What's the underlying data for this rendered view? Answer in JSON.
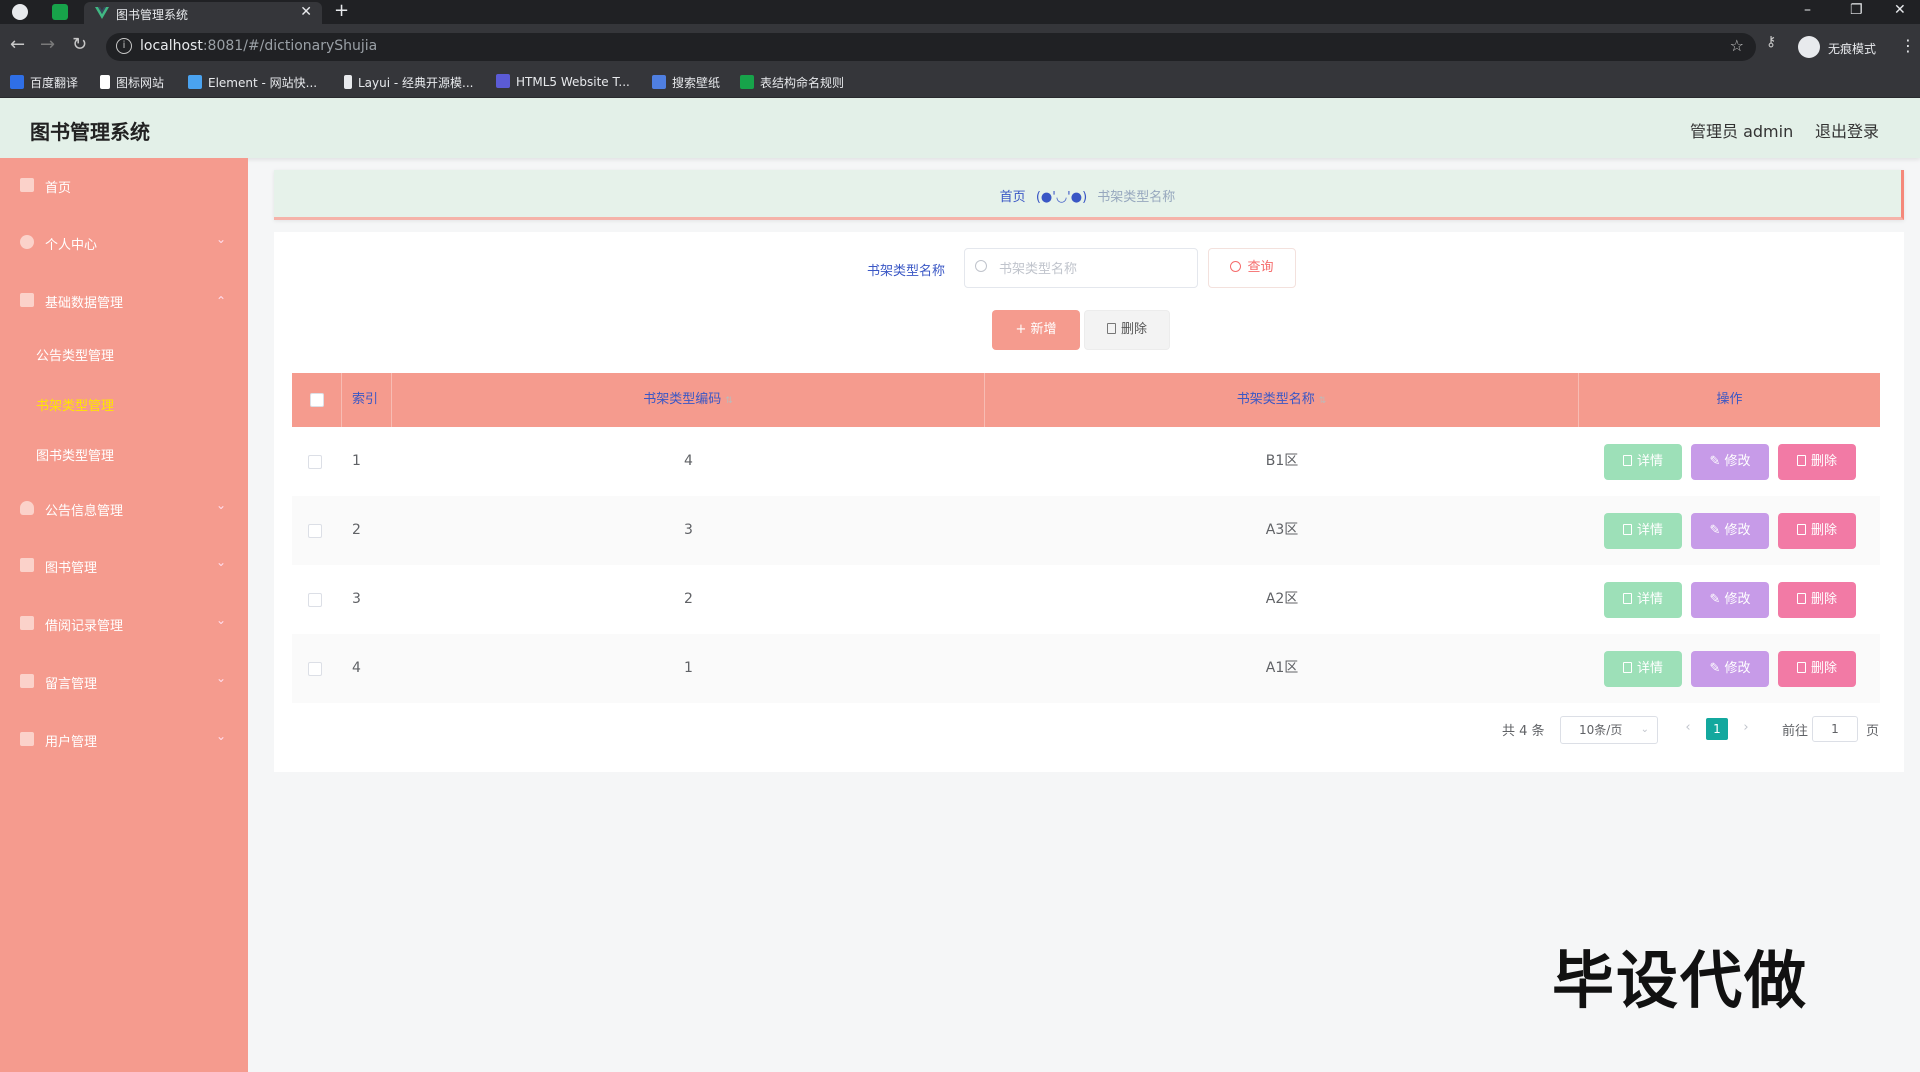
{
  "browser": {
    "tab_title": "图书管理系统",
    "url_host": "localhost",
    "url_path": ":8081/#/dictionaryShujia",
    "incognito_label": "无痕模式",
    "bookmarks": [
      {
        "label": "百度翻译",
        "color": "#2f6fe6"
      },
      {
        "label": "图标网站",
        "color": "#ffffff"
      },
      {
        "label": "Element - 网站快...",
        "color": "#4aa3f0"
      },
      {
        "label": "Layui - 经典开源模...",
        "color": "#e8eaed"
      },
      {
        "label": "HTML5 Website T...",
        "color": "#5b5bd6"
      },
      {
        "label": "搜索壁纸",
        "color": "#4f7fe0"
      },
      {
        "label": "表结构命名规则",
        "color": "#17a34a"
      }
    ]
  },
  "header": {
    "title": "图书管理系统",
    "admin_label": "管理员 admin",
    "logout_label": "退出登录"
  },
  "sidebar": {
    "items": [
      {
        "label": "首页",
        "icon": "home-icon"
      },
      {
        "label": "个人中心",
        "icon": "user-icon"
      },
      {
        "label": "基础数据管理",
        "icon": "database-icon"
      },
      {
        "label": "公告信息管理",
        "icon": "bulb-icon"
      },
      {
        "label": "图书管理",
        "icon": "book-icon"
      },
      {
        "label": "借阅记录管理",
        "icon": "grid-icon"
      },
      {
        "label": "留言管理",
        "icon": "message-icon"
      },
      {
        "label": "用户管理",
        "icon": "users-icon"
      }
    ],
    "sub_items": [
      {
        "label": "公告类型管理"
      },
      {
        "label": "书架类型管理"
      },
      {
        "label": "图书类型管理"
      }
    ]
  },
  "breadcrumb": {
    "home": "首页",
    "face": "(●'◡'●)",
    "current": "书架类型名称"
  },
  "search": {
    "label": "书架类型名称",
    "placeholder": "书架类型名称",
    "query_button": "查询"
  },
  "actions": {
    "add_label": "新增",
    "delete_label": "删除"
  },
  "table": {
    "headers": [
      "索引",
      "书架类型编码",
      "书架类型名称",
      "操作"
    ],
    "rows": [
      {
        "index": "1",
        "code": "4",
        "name": "B1区"
      },
      {
        "index": "2",
        "code": "3",
        "name": "A3区"
      },
      {
        "index": "3",
        "code": "2",
        "name": "A2区"
      },
      {
        "index": "4",
        "code": "1",
        "name": "A1区"
      }
    ],
    "row_actions": {
      "detail": "详情",
      "edit": "修改",
      "delete": "删除"
    }
  },
  "pagination": {
    "total": "共 4 条",
    "page_size": "10条/页",
    "current_page": "1",
    "goto_label": "前往",
    "goto_value": "1",
    "page_suffix": "页"
  },
  "watermark": "毕设代做",
  "colors": {
    "sidebar": "#f59b8e",
    "header_bg": "#e3f0e8",
    "accent_blue": "#3a57c5",
    "detail": "#9de0b8",
    "edit": "#c79be8",
    "delete": "#f27aa5",
    "page_active": "#13a89e"
  }
}
